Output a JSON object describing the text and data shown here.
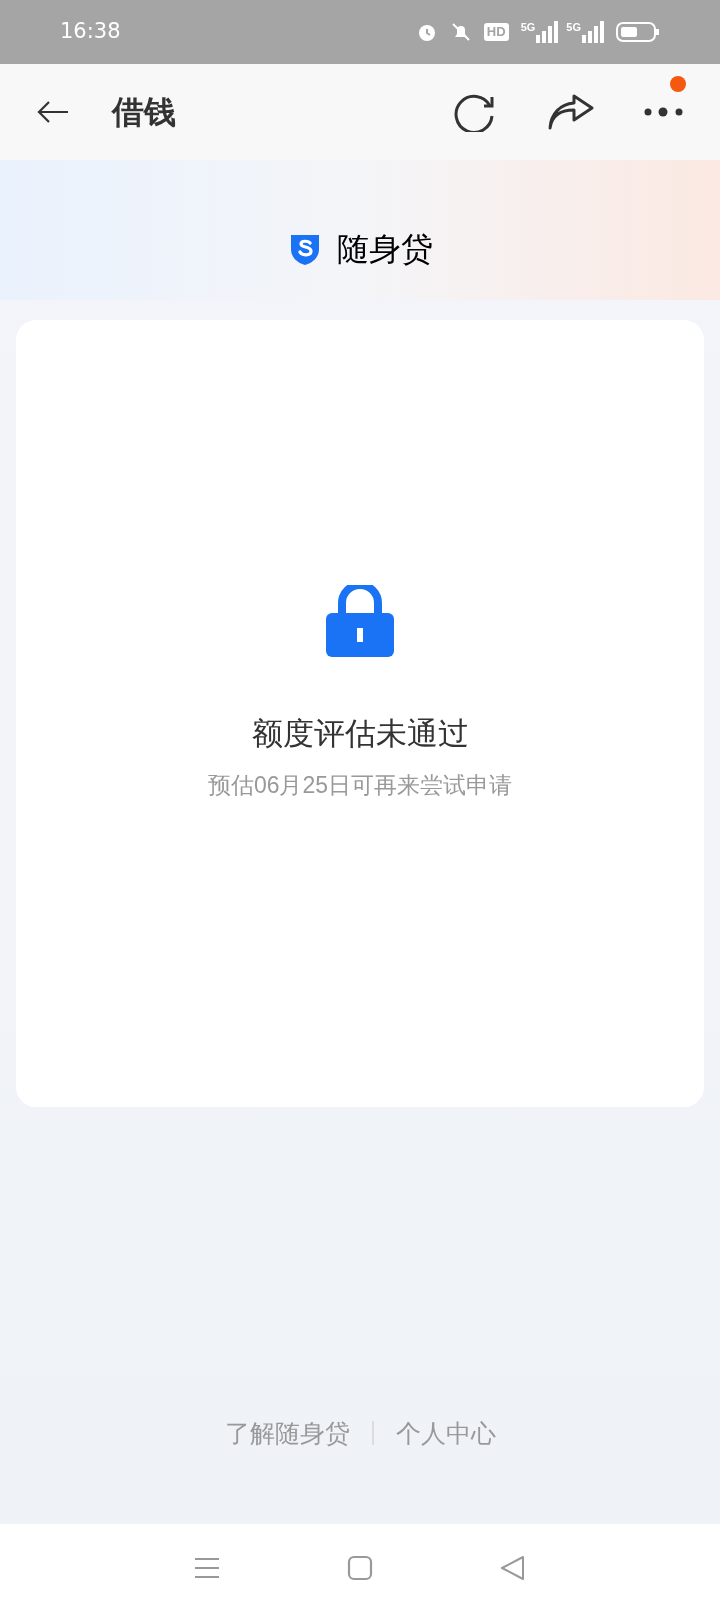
{
  "status_bar": {
    "time": "16:38",
    "hd_label": "HD",
    "signals": [
      {
        "label": "5G"
      },
      {
        "label": "5G"
      }
    ]
  },
  "header": {
    "title": "借钱",
    "more_badge": true
  },
  "brand": {
    "name": "随身贷"
  },
  "card": {
    "title": "额度评估未通过",
    "subtitle": "预估06月25日可再来尝试申请"
  },
  "footer_links": [
    "了解随身贷",
    "个人中心"
  ]
}
